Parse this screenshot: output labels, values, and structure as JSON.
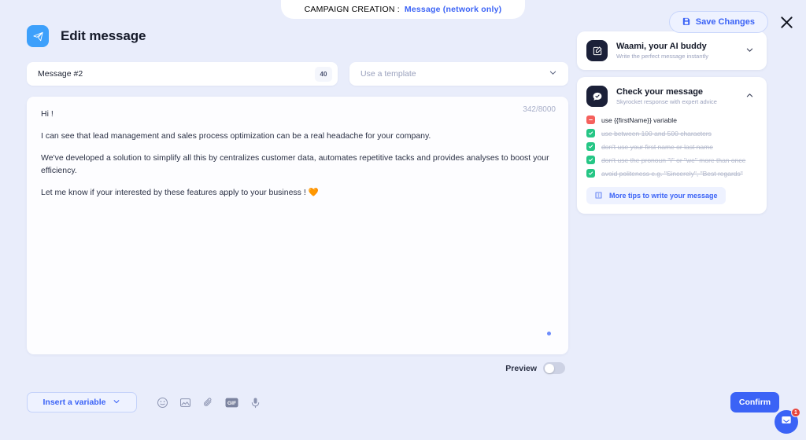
{
  "campaign_bar": {
    "label": "CAMPAIGN CREATION :",
    "value": "Message (network only)"
  },
  "top_actions": {
    "save_label": "Save Changes",
    "save_icon": "save-disk-icon",
    "close_icon": "close-icon"
  },
  "editor": {
    "icon": "send-plane-icon",
    "title": "Edit message",
    "name_field": {
      "value": "Message #2",
      "count_badge": "40"
    },
    "template_field": {
      "placeholder": "Use a template",
      "chevron": "chevron-down-icon"
    },
    "char_counter": "342/8000",
    "message_lines": [
      "Hi !",
      "I can see that lead management and sales process optimization can be a real headache for your company.",
      "We've developed a solution to simplify all this by centralizes customer data, automates repetitive tacks and provides analyses to boost your efficiency.",
      "Let me know if your interested by these features apply to your business ! 🧡"
    ],
    "preview_label": "Preview",
    "preview_enabled": false
  },
  "bottom_bar": {
    "variable_label": "Insert a variable",
    "variable_chevron": "chevron-down-icon",
    "tools": [
      {
        "name": "emoji-icon"
      },
      {
        "name": "image-icon"
      },
      {
        "name": "attachment-icon"
      },
      {
        "name": "gif-icon"
      },
      {
        "name": "microphone-icon"
      }
    ],
    "confirm_label": "Confirm"
  },
  "sidebar": {
    "panels": [
      {
        "icon": "edit-square-icon",
        "title": "Waami, your AI buddy",
        "subtitle": "Write the perfect message instantly",
        "chevron": "chevron-down-icon",
        "expanded": false
      },
      {
        "icon": "message-check-icon",
        "title": "Check your message",
        "subtitle": "Skyrocket response with expert advice",
        "chevron": "chevron-up-icon",
        "expanded": true
      }
    ],
    "checks": [
      {
        "text": "use {{firstName}} variable",
        "status": "fail"
      },
      {
        "text": "use between 100 and 500 characters",
        "status": "pass"
      },
      {
        "text": "don't use your first name or last name",
        "status": "pass"
      },
      {
        "text": "don't use the pronoun \"I\" or \"we\" more than once",
        "status": "pass"
      },
      {
        "text": "avoid politeness e.g. \"Sincerely\", \"Best regards\"",
        "status": "pass"
      }
    ],
    "tips_label": "More tips to write your message",
    "tips_icon": "book-icon"
  },
  "chat_launcher": {
    "icon": "chat-bubble-icon",
    "badge": "1"
  },
  "colors": {
    "accent_blue": "#3b63f6",
    "icon_blue": "#3da0fb",
    "background": "#e9edfb",
    "panel_dark": "#1b2038",
    "pass_green": "#25c685",
    "fail_red": "#f5605c",
    "badge_red": "#e8453c"
  }
}
